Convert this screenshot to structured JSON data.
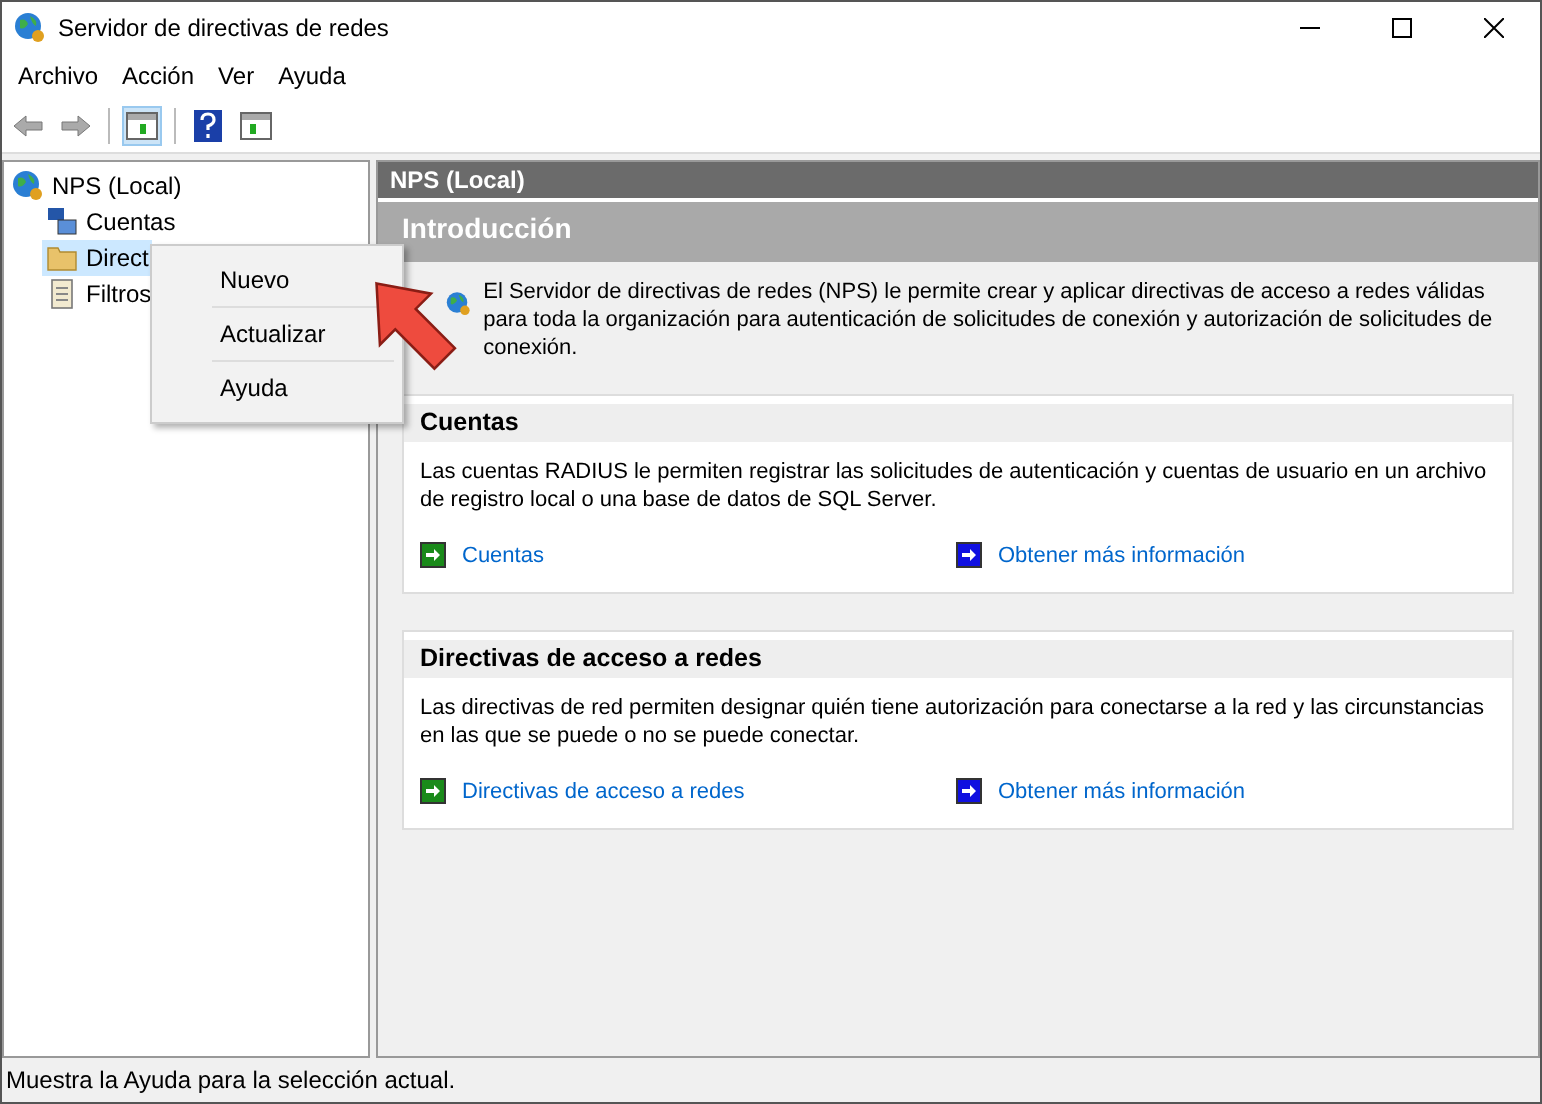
{
  "window": {
    "title": "Servidor de directivas de redes"
  },
  "menu": [
    "Archivo",
    "Acción",
    "Ver",
    "Ayuda"
  ],
  "tree": [
    {
      "label": "NPS (Local)",
      "selected": false,
      "children": [
        {
          "label": "Cuentas",
          "selected": false
        },
        {
          "label": "Direct",
          "selected": true
        },
        {
          "label": "Filtros",
          "selected": false
        }
      ]
    }
  ],
  "context_menu": [
    "Nuevo",
    "Actualizar",
    "Ayuda"
  ],
  "pane_header": "NPS (Local)",
  "intro": {
    "title": "Introducción",
    "text": "El Servidor de directivas de redes (NPS) le permite crear y aplicar directivas de acceso a redes válidas para toda la organización para autenticación de solicitudes de conexión y autorización de solicitudes de conexión."
  },
  "sections": [
    {
      "title": "Cuentas",
      "text": "Las cuentas RADIUS le permiten registrar las solicitudes de autenticación y cuentas de usuario en un archivo de registro local o una base de datos de SQL Server.",
      "links": [
        {
          "label": "Cuentas",
          "kind": "action"
        },
        {
          "label": "Obtener más información",
          "kind": "info"
        }
      ]
    },
    {
      "title": "Directivas de acceso a redes",
      "text": "Las directivas de red permiten designar quién tiene autorización para conectarse a la red y las circunstancias en las que se puede o no se puede conectar.",
      "links": [
        {
          "label": "Directivas de acceso a redes",
          "kind": "action"
        },
        {
          "label": "Obtener más información",
          "kind": "info"
        }
      ]
    }
  ],
  "status_bar": "Muestra la Ayuda para la selección actual."
}
